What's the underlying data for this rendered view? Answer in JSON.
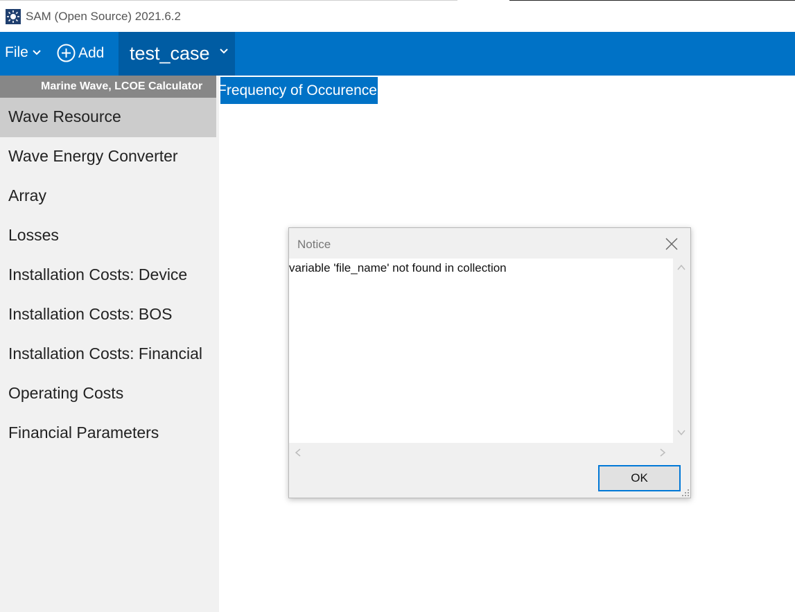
{
  "window": {
    "title": "SAM (Open Source) 2021.6.2",
    "icon": "sun-icon"
  },
  "toolbar": {
    "file_label": "File",
    "add_label": "Add",
    "case_name": "test_case",
    "accent_color": "#0072c6"
  },
  "sidebar": {
    "config_title": "Marine Wave, LCOE Calculator",
    "items": [
      {
        "label": "Wave Resource",
        "active": true
      },
      {
        "label": "Wave Energy Converter",
        "active": false
      },
      {
        "label": "Array",
        "active": false
      },
      {
        "label": "Losses",
        "active": false
      },
      {
        "label": "Installation Costs: Device",
        "active": false
      },
      {
        "label": "Installation Costs: BOS",
        "active": false
      },
      {
        "label": "Installation Costs: Financial",
        "active": false
      },
      {
        "label": "Operating Costs",
        "active": false
      },
      {
        "label": "Financial Parameters",
        "active": false
      }
    ]
  },
  "main": {
    "tab_label": "Frequency of Occurence"
  },
  "dialog": {
    "title": "Notice",
    "message": "variable 'file_name' not found in collection",
    "ok_label": "OK"
  }
}
